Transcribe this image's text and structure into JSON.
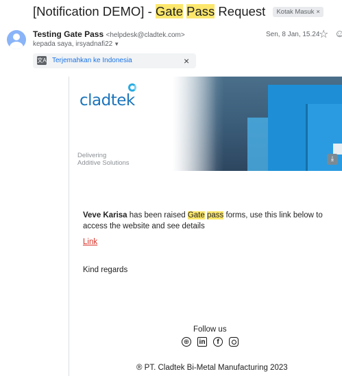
{
  "email": {
    "subject_prefix": "[Notification DEMO] - ",
    "subject_hl1": "Gate",
    "subject_space": " ",
    "subject_hl2": "Pass",
    "subject_suffix": " Request",
    "label_chip": "Kotak Masuk",
    "label_chip_close": "×",
    "sender_name": "Testing Gate Pass",
    "sender_email": "<helpdesk@cladtek.com>",
    "recipient_line": "kepada saya, irsyadnafi22",
    "date": "Sen, 8 Jan, 15.24"
  },
  "translate": {
    "label": "Terjemahkan ke Indonesia",
    "close": "×"
  },
  "banner": {
    "logo_text": "cladtek",
    "tagline_line1": "Delivering",
    "tagline_line2": "Additive Solutions"
  },
  "message": {
    "name": "Veve Karisa",
    "text_before": " has been raised ",
    "hl_gate": "Gate",
    "hl_space": " ",
    "hl_pass": "pass",
    "text_after": " forms, use this link below to access the website and see details",
    "link_label": "Link",
    "regards": "Kind regards"
  },
  "footer": {
    "follow": "Follow us",
    "copyright": "® PT. Cladtek Bi-Metal Manufacturing 2023",
    "social_icons": [
      "globe-icon",
      "linkedin-icon",
      "facebook-icon",
      "instagram-icon"
    ]
  },
  "colors": {
    "highlight": "#fce76c",
    "link": "#d93025",
    "brand_blue": "#1b75bc",
    "translate_link": "#1a73e8"
  }
}
